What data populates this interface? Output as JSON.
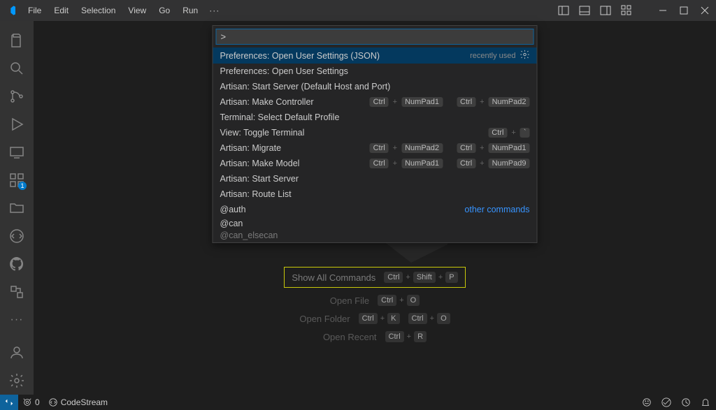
{
  "titlebar": {
    "menus": [
      "File",
      "Edit",
      "Selection",
      "View",
      "Go",
      "Run"
    ],
    "ellipsis": "···"
  },
  "activitybar": {
    "extensions_badge": "1"
  },
  "quickinput": {
    "value": ">",
    "recently_used": "recently used",
    "items": [
      {
        "label": "Preferences: Open User Settings (JSON)",
        "selected": true,
        "recent": true
      },
      {
        "label": "Preferences: Open User Settings"
      },
      {
        "label": "Artisan: Start Server (Default Host and Port)"
      },
      {
        "label": "Artisan: Make Controller",
        "keys": [
          [
            "Ctrl",
            "NumPad1"
          ],
          [
            "Ctrl",
            "NumPad2"
          ]
        ]
      },
      {
        "label": "Terminal: Select Default Profile"
      },
      {
        "label": "View: Toggle Terminal",
        "keys": [
          [
            "Ctrl",
            "`"
          ]
        ]
      },
      {
        "label": "Artisan: Migrate",
        "keys": [
          [
            "Ctrl",
            "NumPad2"
          ],
          [
            "Ctrl",
            "NumPad1"
          ]
        ]
      },
      {
        "label": "Artisan: Make Model",
        "keys": [
          [
            "Ctrl",
            "NumPad1"
          ],
          [
            "Ctrl",
            "NumPad9"
          ]
        ]
      },
      {
        "label": "Artisan: Start Server"
      },
      {
        "label": "Artisan: Route List"
      }
    ],
    "footer_label": "@auth",
    "footer_link": "other commands",
    "extra1": "@can",
    "extra2": "@can_elsecan"
  },
  "hints": {
    "show_all": "Show All Commands",
    "show_all_keys": [
      "Ctrl",
      "Shift",
      "P"
    ],
    "open_file": "Open File",
    "open_file_keys": [
      "Ctrl",
      "O"
    ],
    "open_folder": "Open Folder",
    "open_folder_keys1": [
      "Ctrl",
      "K"
    ],
    "open_folder_keys2": [
      "Ctrl",
      "O"
    ],
    "open_recent": "Open Recent",
    "open_recent_keys": [
      "Ctrl",
      "R"
    ]
  },
  "statusbar": {
    "ports": "0",
    "codestream": "CodeStream"
  }
}
